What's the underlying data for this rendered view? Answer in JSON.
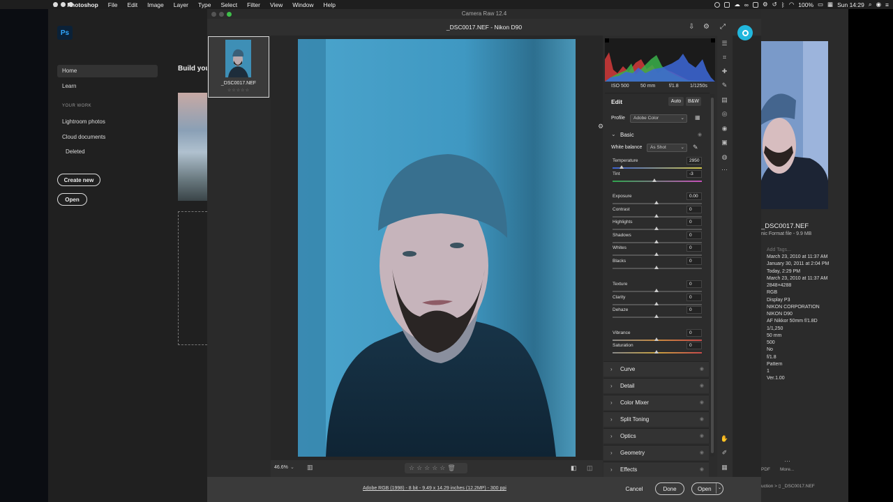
{
  "menubar": {
    "app": "Photoshop",
    "items": [
      "File",
      "Edit",
      "Image",
      "Layer",
      "Type",
      "Select",
      "Filter",
      "View",
      "Window",
      "Help"
    ],
    "battery": "100%",
    "clock": "Sun 14:29"
  },
  "ps_home": {
    "logo": "Ps",
    "nav_home": "Home",
    "nav_learn": "Learn",
    "section_your_work": "YOUR WORK",
    "nav_lightroom": "Lightroom photos",
    "nav_cloud": "Cloud documents",
    "nav_deleted": "Deleted",
    "create_new": "Create new",
    "open": "Open",
    "build_heading": "Build you"
  },
  "camera_raw": {
    "window_title": "Camera Raw 12.4",
    "document_title": "_DSC0017.NEF  -  Nikon D90",
    "filmstrip_name": "_DSC0017.NEF",
    "filmstrip_stars": "☆☆☆☆☆",
    "zoom": "46.6%",
    "footer_link": "Adobe RGB (1998) - 8 bit - 9.49 x 14.29 inches (12.2MP) - 300 ppi",
    "cancel": "Cancel",
    "done": "Done",
    "open": "Open",
    "camera": {
      "iso": "ISO 500",
      "focal": "50 mm",
      "aperture": "f/1.8",
      "shutter": "1/1250s"
    },
    "edit": {
      "title": "Edit",
      "auto": "Auto",
      "bw": "B&W",
      "profile_label": "Profile",
      "profile_value": "Adobe Color",
      "basic": "Basic",
      "wb_label": "White balance",
      "wb_value": "As Shot",
      "sliders": [
        {
          "label": "Temperature",
          "value": "2950",
          "pos": 0.1
        },
        {
          "label": "Tint",
          "value": "-3",
          "pos": 0.48
        },
        {
          "label": "Exposure",
          "value": "0.00",
          "pos": 0.5
        },
        {
          "label": "Contrast",
          "value": "0",
          "pos": 0.5
        },
        {
          "label": "Highlights",
          "value": "0",
          "pos": 0.5
        },
        {
          "label": "Shadows",
          "value": "0",
          "pos": 0.5
        },
        {
          "label": "Whites",
          "value": "0",
          "pos": 0.5
        },
        {
          "label": "Blacks",
          "value": "0",
          "pos": 0.5
        },
        {
          "label": "Texture",
          "value": "0",
          "pos": 0.5
        },
        {
          "label": "Clarity",
          "value": "0",
          "pos": 0.5
        },
        {
          "label": "Dehaze",
          "value": "0",
          "pos": 0.5
        },
        {
          "label": "Vibrance",
          "value": "0",
          "pos": 0.5
        },
        {
          "label": "Saturation",
          "value": "0",
          "pos": 0.5
        }
      ],
      "sections": [
        "Curve",
        "Detail",
        "Color Mixer",
        "Split Toning",
        "Optics",
        "Geometry",
        "Effects"
      ]
    }
  },
  "bridge": {
    "filename": "_DSC0017.NEF",
    "subtitle": "nic Format file - 9.9 MB",
    "add_tags": "Add Tags...",
    "metadata": [
      "March 23, 2010 at 11:37 AM",
      "January 30, 2011 at 2:04 PM",
      "Today, 2:29 PM",
      "March 23, 2010 at 11:37 AM",
      "2848×4288",
      "RGB",
      "Display P3",
      "NIKON CORPORATION",
      "NIKON D90",
      "AF Nikkor 50mm f/1.8D",
      "1/1,250",
      "50 mm",
      "500",
      "No",
      "f/1.8",
      "Pattern",
      "1",
      "Ver.1.00"
    ],
    "pdf": "PDF",
    "more": "More...",
    "breadcrumb_a": "uction",
    "breadcrumb_b": "_DSC0017.NEF"
  }
}
